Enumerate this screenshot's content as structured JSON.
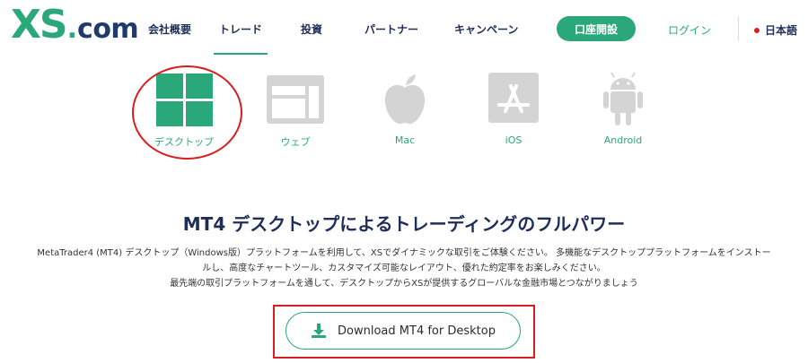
{
  "header": {
    "logo_xs": "XS",
    "logo_dot": ".",
    "logo_com": "com",
    "nav": [
      {
        "label": "会社概要"
      },
      {
        "label": "トレード"
      },
      {
        "label": "投資"
      },
      {
        "label": "パートナー"
      },
      {
        "label": "キャンペーン"
      }
    ],
    "open_account": "口座開設",
    "login": "ログイン",
    "language": "日本語"
  },
  "platforms": [
    {
      "label": "デスクトップ",
      "icon": "windows-icon",
      "selected": true
    },
    {
      "label": "ウェブ",
      "icon": "web-browser-icon",
      "selected": false
    },
    {
      "label": "Mac",
      "icon": "apple-icon",
      "selected": false
    },
    {
      "label": "iOS",
      "icon": "app-store-icon",
      "selected": false
    },
    {
      "label": "Android",
      "icon": "android-icon",
      "selected": false
    }
  ],
  "main": {
    "title": "MT4 デスクトップによるトレーディングのフルパワー",
    "desc_lines": [
      "MetaTrader4 (MT4) デスクトップ（Windows版）プラットフォームを利用して、XSでダイナミックな取引をご体験ください。 多機能なデスクトッププラットフォームをインストー",
      "ルし、高度なチャートツール、カスタマイズ可能なレイアウト、優れた約定率をお楽しみください。",
      "最先端の取引プラットフォームを通して、デスクトップからXSが提供するグローバルな金融市場とつながりましょう"
    ],
    "download_label": "Download MT4 for Desktop"
  },
  "colors": {
    "brand_green": "#2ba87a",
    "navy": "#1f2e58",
    "annotation_red": "#d81e1e",
    "inactive_grey": "#d4d4d4"
  }
}
